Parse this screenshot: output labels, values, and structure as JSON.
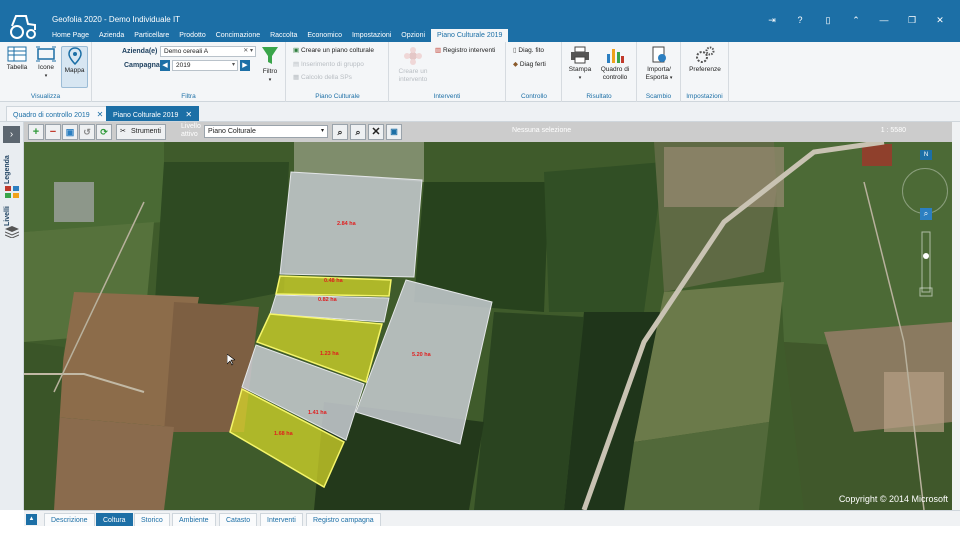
{
  "app": {
    "title": "Geofolia 2020 - Demo Individuale IT",
    "menu": [
      "Home Page",
      "Azienda",
      "Particellare",
      "Prodotto",
      "Concimazione",
      "Raccolta",
      "Economico",
      "Impostazioni",
      "Opzioni",
      "Piano Culturale 2019"
    ],
    "active_menu": "Piano Culturale 2019"
  },
  "ribbon": {
    "visualizza": {
      "label": "Visualizza",
      "tabella": "Tabella",
      "icone": "Icone",
      "mappa": "Mappa"
    },
    "filtra": {
      "label": "Filtra",
      "azienda_label": "Azienda(e)",
      "azienda_value": "Demo cereali A",
      "campagna_label": "Campagna",
      "campagna_value": "2019",
      "filtro": "Filtro"
    },
    "piano_culturale": {
      "label": "Piano Culturale",
      "crea": "Creare un piano colturale",
      "inserimento": "Inserimento di gruppo",
      "calcolo": "Calcolo della SPs"
    },
    "interventi": {
      "label": "Interventi",
      "creare": "Creare un intervento",
      "registro": "Registro interventi"
    },
    "controllo": {
      "label": "Controllo",
      "fito": "Diag. fito",
      "ferti": "Diag ferti"
    },
    "risultato": {
      "label": "Risultato",
      "stampa": "Stampa",
      "quadro": "Quadro di controllo"
    },
    "scambio": {
      "label": "Scambio",
      "importa": "Importa/ Esporta"
    },
    "impostazioni": {
      "label": "Impostazioni",
      "preferenze": "Preferenze"
    }
  },
  "doc_tabs": [
    {
      "label": "Quadro di controllo 2019",
      "active": false
    },
    {
      "label": "Piano Colturale 2019",
      "active": true
    }
  ],
  "left_rail": {
    "legenda": "Legenda",
    "livelli": "Livelli"
  },
  "map_toolbar": {
    "strumenti": "Strumenti",
    "livello_label": "Livello attivo",
    "layer_value": "Piano Colturale",
    "selection_status": "Nessuna selezione",
    "scale": "1 : 5580"
  },
  "map": {
    "north_label": "N",
    "copyright": "Copyright © 2014 Microsoft",
    "plots": [
      {
        "label": "2.84 ha",
        "highlighted": false
      },
      {
        "label": "0.48 ha",
        "highlighted": true
      },
      {
        "label": "0.82 ha",
        "highlighted": false
      },
      {
        "label": "1.23 ha",
        "highlighted": true
      },
      {
        "label": "5.20 ha",
        "highlighted": false
      },
      {
        "label": "1.41 ha",
        "highlighted": false
      },
      {
        "label": "1.68 ha",
        "highlighted": true
      }
    ]
  },
  "bottom_tabs": [
    "Descrizione",
    "Coltura",
    "Storico",
    "Ambiente",
    "Catasto",
    "Interventi",
    "Registro campagna"
  ],
  "active_bottom_tab": "Coltura",
  "colors": {
    "brand_blue": "#1c6fa6",
    "plot_fill": "#c8ccd2",
    "plot_highlight": "#dede2a",
    "plot_label": "#e01e1e"
  }
}
